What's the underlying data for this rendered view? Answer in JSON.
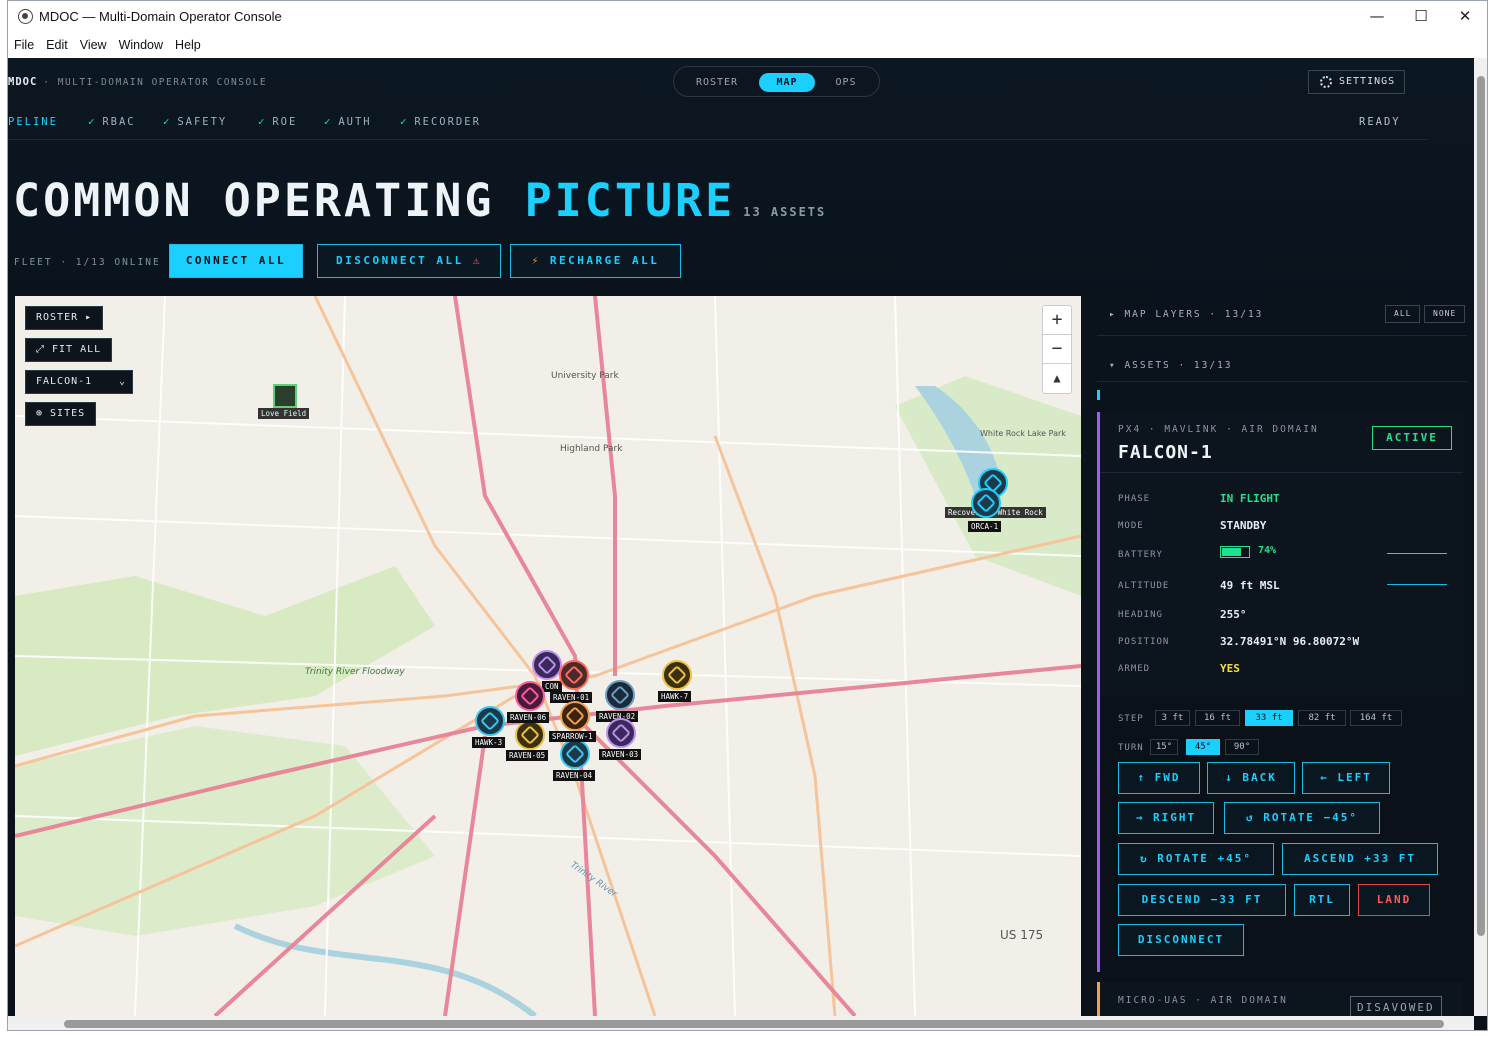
{
  "window": {
    "title": "MDOC — Multi-Domain Operator Console",
    "minimize": "—",
    "maximize": "☐",
    "close": "✕"
  },
  "menu": [
    "File",
    "Edit",
    "View",
    "Window",
    "Help"
  ],
  "brand": {
    "name": "MDOC",
    "subtitle": "· MULTI-DOMAIN OPERATOR CONSOLE"
  },
  "tabs": [
    "ROSTER",
    "MAP",
    "OPS"
  ],
  "settings_label": "SETTINGS",
  "pipeline": {
    "items": [
      "PELINE",
      "RBAC",
      "SAFETY",
      "ROE",
      "AUTH",
      "RECORDER"
    ],
    "status": "READY"
  },
  "hero": {
    "w1": "COMMON OPERATING",
    "w2": "PICTURE",
    "count": "13 ASSETS"
  },
  "fleet": {
    "label": "FLEET · 1/13 ONLINE",
    "connect": "CONNECT ALL",
    "disconnect": "DISCONNECT ALL",
    "disconnect_icon": "⚠",
    "recharge": "RECHARGE ALL",
    "recharge_icon": "⚡"
  },
  "map": {
    "roster_btn": "ROSTER ▸",
    "fit_btn": "⤢ FIT ALL",
    "select_value": "FALCON-1",
    "sites_btn": "⊕ SITES",
    "zoom_in": "+",
    "zoom_out": "−",
    "compass": "▲",
    "places": [
      "University Park",
      "Highland Park",
      "White Rock Lake Park",
      "Trinity River Floodway",
      "Love Field",
      "US 175",
      "Trinity River"
    ],
    "site_labels": [
      "Love Field",
      "Recovery · White Rock"
    ],
    "markers": [
      "ORCA-1",
      "RAVEN-01",
      "RAVEN-02",
      "RAVEN-03",
      "RAVEN-04",
      "RAVEN-05",
      "RAVEN-06",
      "HAWK-7",
      "HAWK-3",
      "SPARROW-1",
      "CON"
    ]
  },
  "side": {
    "layers": "▸ MAP LAYERS · 13/13",
    "all": "ALL",
    "none": "NONE",
    "assets": "▾ ASSETS · 13/13",
    "card": {
      "domain": "PX4 · MAVLINK · AIR DOMAIN",
      "name": "FALCON-1",
      "status": "ACTIVE",
      "rows": [
        {
          "k": "PHASE",
          "v": "IN FLIGHT"
        },
        {
          "k": "MODE",
          "v": "STANDBY"
        },
        {
          "k": "BATTERY",
          "v": "74%"
        },
        {
          "k": "ALTITUDE",
          "v": "49 ft MSL"
        },
        {
          "k": "HEADING",
          "v": "255°"
        },
        {
          "k": "POSITION",
          "v": "32.78491°N 96.80072°W"
        },
        {
          "k": "ARMED",
          "v": "YES"
        }
      ],
      "battery_pct": 74,
      "step_label": "STEP",
      "steps": [
        "3 ft",
        "16 ft",
        "33 ft",
        "82 ft",
        "164 ft"
      ],
      "step_selected": "33 ft",
      "turn_label": "TURN",
      "turns": [
        "15°",
        "45°",
        "90°"
      ],
      "turn_selected": "45°",
      "cmds": [
        "↑ FWD",
        "↓ BACK",
        "← LEFT",
        "→ RIGHT",
        "↺ ROTATE −45°",
        "↻ ROTATE +45°",
        "ASCEND +33 FT",
        "DESCEND −33 FT",
        "RTL",
        "LAND",
        "DISCONNECT"
      ]
    },
    "next_card": {
      "domain": "MICRO-UAS · AIR DOMAIN",
      "status": "DISAVOWED"
    }
  },
  "colors": {
    "accent": "#1bd0ff",
    "active": "#21e08e",
    "warn": "#ff5a5a",
    "card_border": "#a45bf0"
  }
}
